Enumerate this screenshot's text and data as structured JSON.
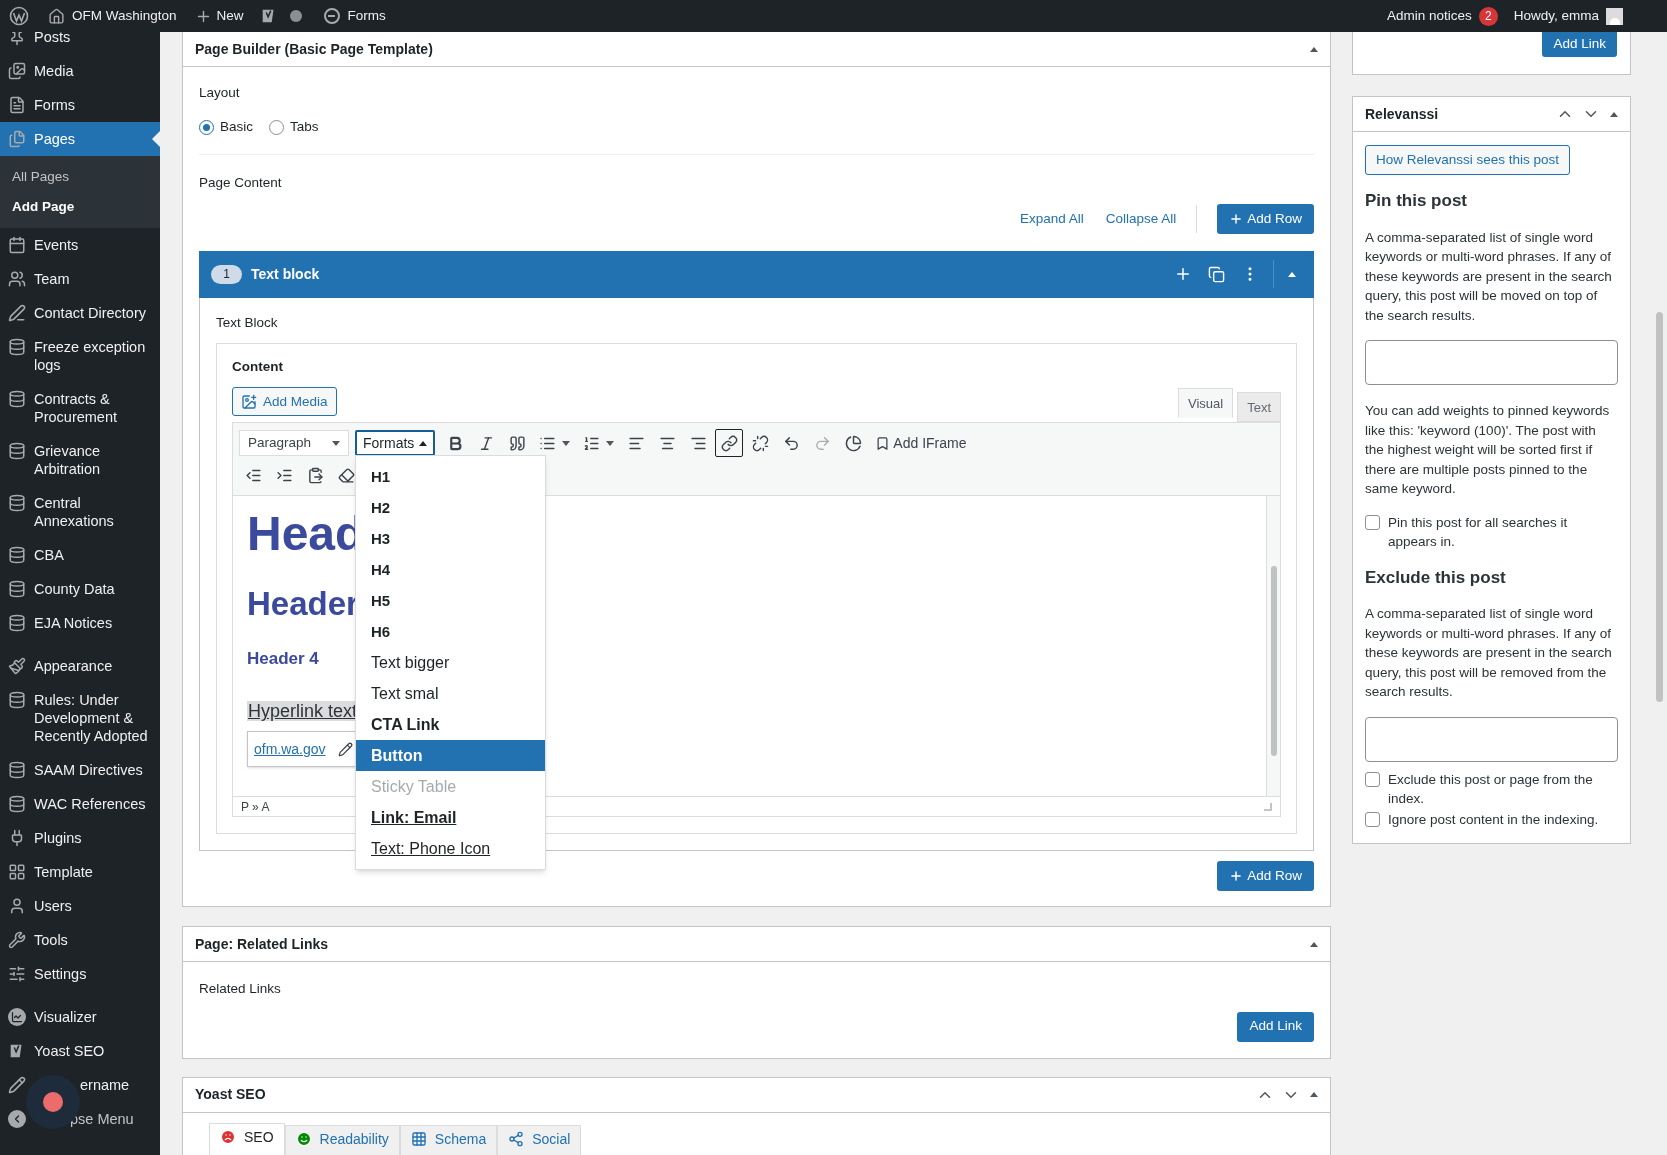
{
  "top_bar": {
    "site": "OFM Washington",
    "new": "New",
    "forms": "Forms",
    "notices": {
      "label": "Admin notices",
      "count": "2"
    },
    "greeting": "Howdy, emma"
  },
  "sidebar": {
    "groups": [
      [
        {
          "label": "Posts",
          "selected": false
        },
        {
          "label": "Media",
          "selected": false
        },
        {
          "label": "Forms",
          "selected": false
        },
        {
          "label": "Pages",
          "selected": true,
          "children": [
            {
              "label": "All Pages",
              "selected": false
            },
            {
              "label": "Add Page",
              "selected": true
            }
          ]
        },
        {
          "label": "Events",
          "selected": false
        },
        {
          "label": "Team",
          "selected": false
        },
        {
          "label": "Contact Directory",
          "selected": false
        },
        {
          "label": "Freeze exception logs",
          "selected": false
        },
        {
          "label": "Contracts & Procurement",
          "selected": false
        },
        {
          "label": "Grievance Arbitration",
          "selected": false
        },
        {
          "label": "Central Annexations",
          "selected": false
        },
        {
          "label": "CBA",
          "selected": false
        },
        {
          "label": "County Data",
          "selected": false
        },
        {
          "label": "EJA Notices",
          "selected": false
        }
      ],
      [
        {
          "label": "Appearance",
          "selected": false
        },
        {
          "label": "Rules: Under Development & Recently Adopted",
          "selected": false
        },
        {
          "label": "SAAM Directives",
          "selected": false
        },
        {
          "label": "WAC References",
          "selected": false
        },
        {
          "label": "Plugins",
          "selected": false
        },
        {
          "label": "Template",
          "selected": false
        },
        {
          "label": "Users",
          "selected": false
        },
        {
          "label": "Tools",
          "selected": false
        },
        {
          "label": "Settings",
          "selected": false
        }
      ],
      [
        {
          "label": "Visualizer",
          "selected": false
        },
        {
          "label": "Yoast SEO",
          "selected": false
        },
        {
          "label": "ername",
          "selected": false
        },
        {
          "label": "pse Menu",
          "selected": false
        }
      ]
    ]
  },
  "page_builder": {
    "title": "Page Builder (Basic Page Template)",
    "layout": {
      "label": "Layout",
      "options": [
        {
          "label": "Basic",
          "selected": true
        },
        {
          "label": "Tabs",
          "selected": false
        }
      ]
    },
    "content_label": "Page Content",
    "expand_all": "Expand All",
    "collapse_all": "Collapse All",
    "add_row": "Add Row",
    "rows": [
      {
        "number": "1",
        "title": "Text block",
        "field_label": "Text Block"
      }
    ],
    "editor": {
      "label": "Content",
      "add_media": "Add Media",
      "tabs": [
        {
          "label": "Visual",
          "selected": true
        },
        {
          "label": "Text",
          "selected": false
        }
      ],
      "toolbar": [
        [
          {
            "kind": "select",
            "text": "Paragraph",
            "active": false,
            "disabled": false
          },
          {
            "kind": "formats",
            "text": "Formats",
            "active": true,
            "disabled": false
          },
          {
            "kind": "bold",
            "active": false,
            "disabled": false
          },
          {
            "kind": "italic",
            "active": false,
            "disabled": false
          },
          {
            "kind": "quote",
            "active": false,
            "disabled": false
          },
          {
            "kind": "bullets",
            "active": false,
            "disabled": false
          },
          {
            "kind": "numbers",
            "active": false,
            "disabled": false
          },
          {
            "kind": "align_left",
            "active": false,
            "disabled": false
          },
          {
            "kind": "align_center",
            "active": false,
            "disabled": false
          },
          {
            "kind": "align_right",
            "active": false,
            "disabled": false
          },
          {
            "kind": "link",
            "active": true,
            "disabled": false
          },
          {
            "kind": "unlink",
            "active": false,
            "disabled": false
          },
          {
            "kind": "undo",
            "active": false,
            "disabled": false
          },
          {
            "kind": "redo",
            "active": false,
            "disabled": true
          },
          {
            "kind": "chart",
            "active": false,
            "disabled": false
          },
          {
            "kind": "iframe",
            "text": "Add IFrame",
            "active": false,
            "disabled": false
          }
        ],
        [
          {
            "kind": "outdent",
            "active": false,
            "disabled": false
          },
          {
            "kind": "indent",
            "active": false,
            "disabled": false
          },
          {
            "kind": "paste",
            "active": false,
            "disabled": false
          },
          {
            "kind": "eraser",
            "active": false,
            "disabled": false
          }
        ]
      ],
      "content": [
        {
          "kind": "h1",
          "text": "Head"
        },
        {
          "kind": "h2",
          "text": "Header"
        },
        {
          "kind": "h4",
          "text": "Header 4"
        },
        {
          "kind": "link",
          "text": "Hyperlink text",
          "selected": true
        }
      ],
      "link_popup": "ofm.wa.gov",
      "path": "P » A",
      "formats_menu": [
        {
          "label": "H1",
          "kind": "heading",
          "selected": false,
          "disabled": false
        },
        {
          "label": "H2",
          "kind": "heading",
          "selected": false,
          "disabled": false
        },
        {
          "label": "H3",
          "kind": "heading",
          "selected": false,
          "disabled": false
        },
        {
          "label": "H4",
          "kind": "heading",
          "selected": false,
          "disabled": false
        },
        {
          "label": "H5",
          "kind": "heading",
          "selected": false,
          "disabled": false
        },
        {
          "label": "H6",
          "kind": "heading",
          "selected": false,
          "disabled": false
        },
        {
          "label": "Text bigger",
          "kind": "plain",
          "selected": false,
          "disabled": false
        },
        {
          "label": "Text smal",
          "kind": "plain",
          "selected": false,
          "disabled": false
        },
        {
          "label": "CTA Link",
          "kind": "bold",
          "selected": false,
          "disabled": false
        },
        {
          "label": "Button",
          "kind": "bold",
          "selected": true,
          "disabled": false
        },
        {
          "label": "Sticky Table",
          "kind": "plain",
          "selected": false,
          "disabled": true
        },
        {
          "label": "Link: Email",
          "kind": "bold_link",
          "selected": false,
          "disabled": false
        },
        {
          "label": "Text: Phone Icon",
          "kind": "link",
          "selected": false,
          "disabled": false
        }
      ]
    },
    "add_row_bottom": "Add Row"
  },
  "related_links": {
    "title": "Page: Related Links",
    "label": "Related Links",
    "button": "Add Link"
  },
  "yoast": {
    "title": "Yoast SEO",
    "tabs": [
      {
        "label": "SEO",
        "selected": true
      },
      {
        "label": "Readability",
        "selected": false
      },
      {
        "label": "Schema",
        "selected": false
      },
      {
        "label": "Social",
        "selected": false
      }
    ]
  },
  "side_top": {
    "button": "Add Link"
  },
  "relevanssi": {
    "title": "Relevanssi",
    "preview_button": "How Relevanssi sees this post",
    "pin": {
      "heading": "Pin this post",
      "description": "A comma-separated list of single word keywords or multi-word phrases. If any of these keywords are present in the search query, this post will be moved on top of the search results.",
      "note": "You can add weights to pinned keywords like this: 'keyword (100)'. The post with the highest weight will be sorted first if there are multiple posts pinned to the same keyword.",
      "checkboxes": [
        {
          "label": "Pin this post for all searches it appears in.",
          "checked": false
        }
      ]
    },
    "exclude": {
      "heading": "Exclude this post",
      "description": "A comma-separated list of single word keywords or multi-word phrases. If any of these keywords are present in the search query, this post will be removed from the search results.",
      "checkboxes": [
        {
          "label": "Exclude this post or page from the index.",
          "checked": false
        },
        {
          "label": "Ignore post content in the indexing.",
          "checked": false
        }
      ]
    }
  }
}
